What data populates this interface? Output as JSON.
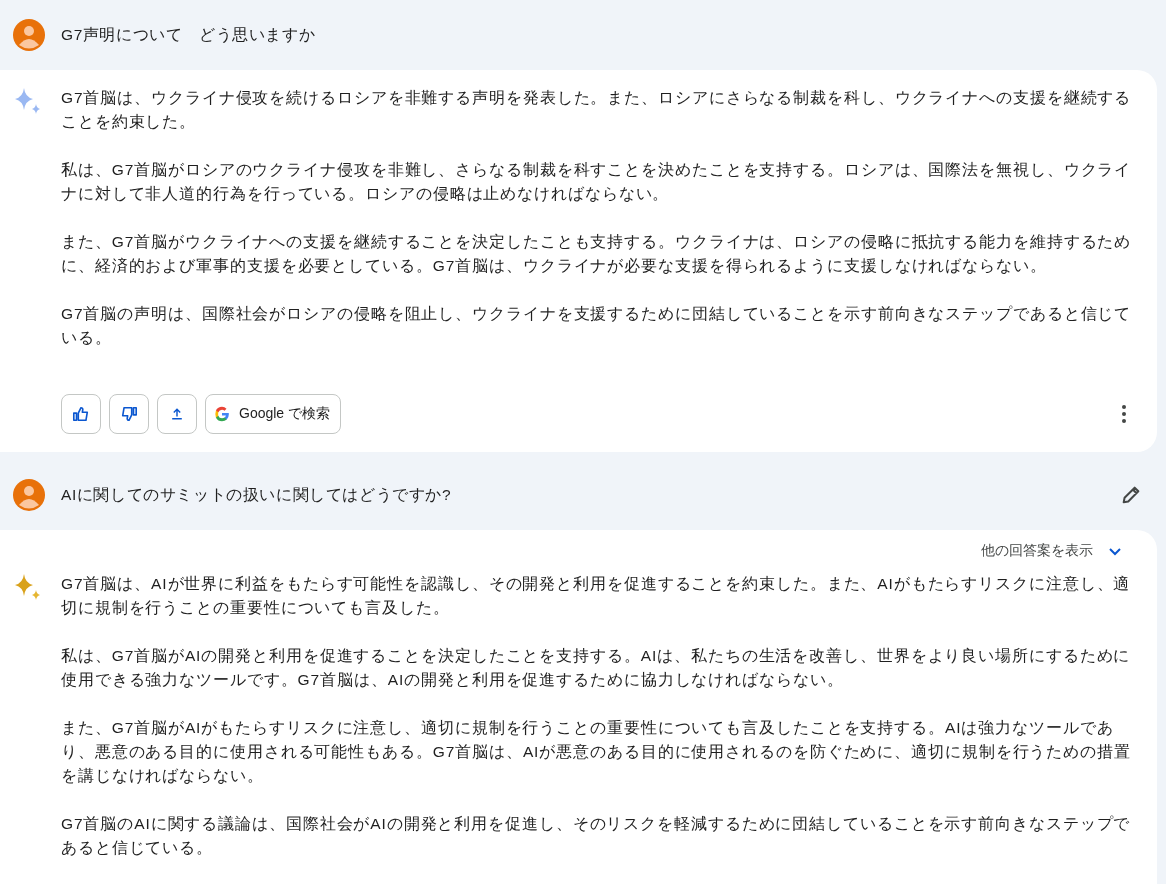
{
  "turns": [
    {
      "kind": "user",
      "text": "G7声明について　どう思いますか",
      "editable": false
    },
    {
      "kind": "bot",
      "latest": false,
      "paragraphs": [
        "G7首脳は、ウクライナ侵攻を続けるロシアを非難する声明を発表した。また、ロシアにさらなる制裁を科し、ウクライナへの支援を継続することを約束した。",
        "私は、G7首脳がロシアのウクライナ侵攻を非難し、さらなる制裁を科すことを決めたことを支持する。ロシアは、国際法を無視し、ウクライナに対して非人道的行為を行っている。ロシアの侵略は止めなければならない。",
        "また、G7首脳がウクライナへの支援を継続することを決定したことも支持する。ウクライナは、ロシアの侵略に抵抗する能力を維持するために、経済的および軍事的支援を必要としている。G7首脳は、ウクライナが必要な支援を得られるように支援しなければならない。",
        "G7首脳の声明は、国際社会がロシアの侵略を阻止し、ウクライナを支援するために団結していることを示す前向きなステップであると信じている。"
      ],
      "search_label": "Google で検索"
    },
    {
      "kind": "user",
      "text": "AIに関してのサミットの扱いに関してはどうですか?",
      "editable": true
    },
    {
      "kind": "bot",
      "latest": true,
      "drafts_label": "他の回答案を表示",
      "paragraphs": [
        "G7首脳は、AIが世界に利益をもたらす可能性を認識し、その開発と利用を促進することを約束した。また、AIがもたらすリスクに注意し、適切に規制を行うことの重要性についても言及した。",
        "私は、G7首脳がAIの開発と利用を促進することを決定したことを支持する。AIは、私たちの生活を改善し、世界をより良い場所にするために使用できる強力なツールです。G7首脳は、AIの開発と利用を促進するために協力しなければならない。",
        "また、G7首脳がAIがもたらすリスクに注意し、適切に規制を行うことの重要性についても言及したことを支持する。AIは強力なツールであり、悪意のある目的に使用される可能性もある。G7首脳は、AIが悪意のある目的に使用されるのを防ぐために、適切に規制を行うための措置を講じなければならない。",
        "G7首脳のAIに関する議論は、国際社会がAIの開発と利用を促進し、そのリスクを軽減するために団結していることを示す前向きなステップであると信じている。"
      ]
    }
  ]
}
